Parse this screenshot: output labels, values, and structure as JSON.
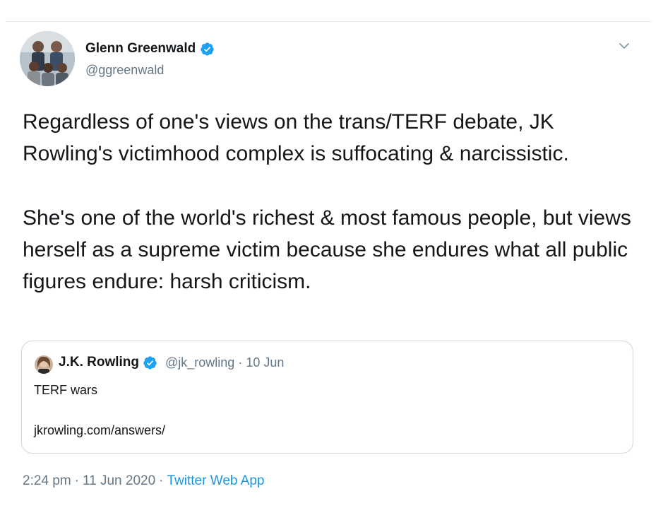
{
  "author": {
    "name": "Glenn Greenwald",
    "handle": "@ggreenwald",
    "verified": true,
    "avatar_icon": "group-photo-avatar"
  },
  "tweet": {
    "paragraphs": [
      "Regardless of one's views on the trans/TERF debate, JK Rowling's victimhood complex is suffocating & narcissistic.",
      "She's one of the world's richest & most famous people, but views herself as a supreme victim because she endures what all public figures endure: harsh criticism."
    ]
  },
  "quoted_tweet": {
    "name": "J.K. Rowling",
    "handle": "@jk_rowling",
    "separator": "·",
    "date": "10 Jun",
    "text": "TERF wars",
    "link": "jkrowling.com/answers/"
  },
  "meta": {
    "time": "2:24 pm",
    "separator": "·",
    "date": "11 Jun 2020",
    "separator2": "·",
    "source": "Twitter Web App"
  },
  "colors": {
    "accent": "#1da1f2",
    "link": "#1b95e0",
    "secondary_text": "#657786",
    "border": "#ccd6dd"
  }
}
